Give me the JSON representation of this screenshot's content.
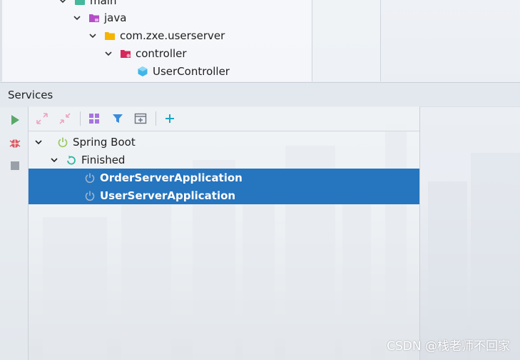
{
  "project_tree": {
    "items": [
      {
        "label": "main",
        "icon": "folder-main-icon"
      },
      {
        "label": "java",
        "icon": "source-folder-icon"
      },
      {
        "label": "com.zxe.userserver",
        "icon": "package-folder-icon"
      },
      {
        "label": "controller",
        "icon": "controller-folder-icon"
      },
      {
        "label": "UserController",
        "icon": "class-icon"
      }
    ]
  },
  "services": {
    "title": "Services",
    "tree": {
      "group": "Spring Boot",
      "status_group": "Finished",
      "apps": [
        "OrderServerApplication",
        "UserServerApplication"
      ]
    }
  },
  "colors": {
    "selection": "#2675bf",
    "run_green": "#59a869",
    "debug_red": "#db5860",
    "filter_blue": "#3a8be0",
    "add_cyan": "#16a8c4",
    "folder_yellow": "#f4b400",
    "java_purple": "#b54ec6"
  },
  "watermark": "CSDN @栈老师不回家"
}
